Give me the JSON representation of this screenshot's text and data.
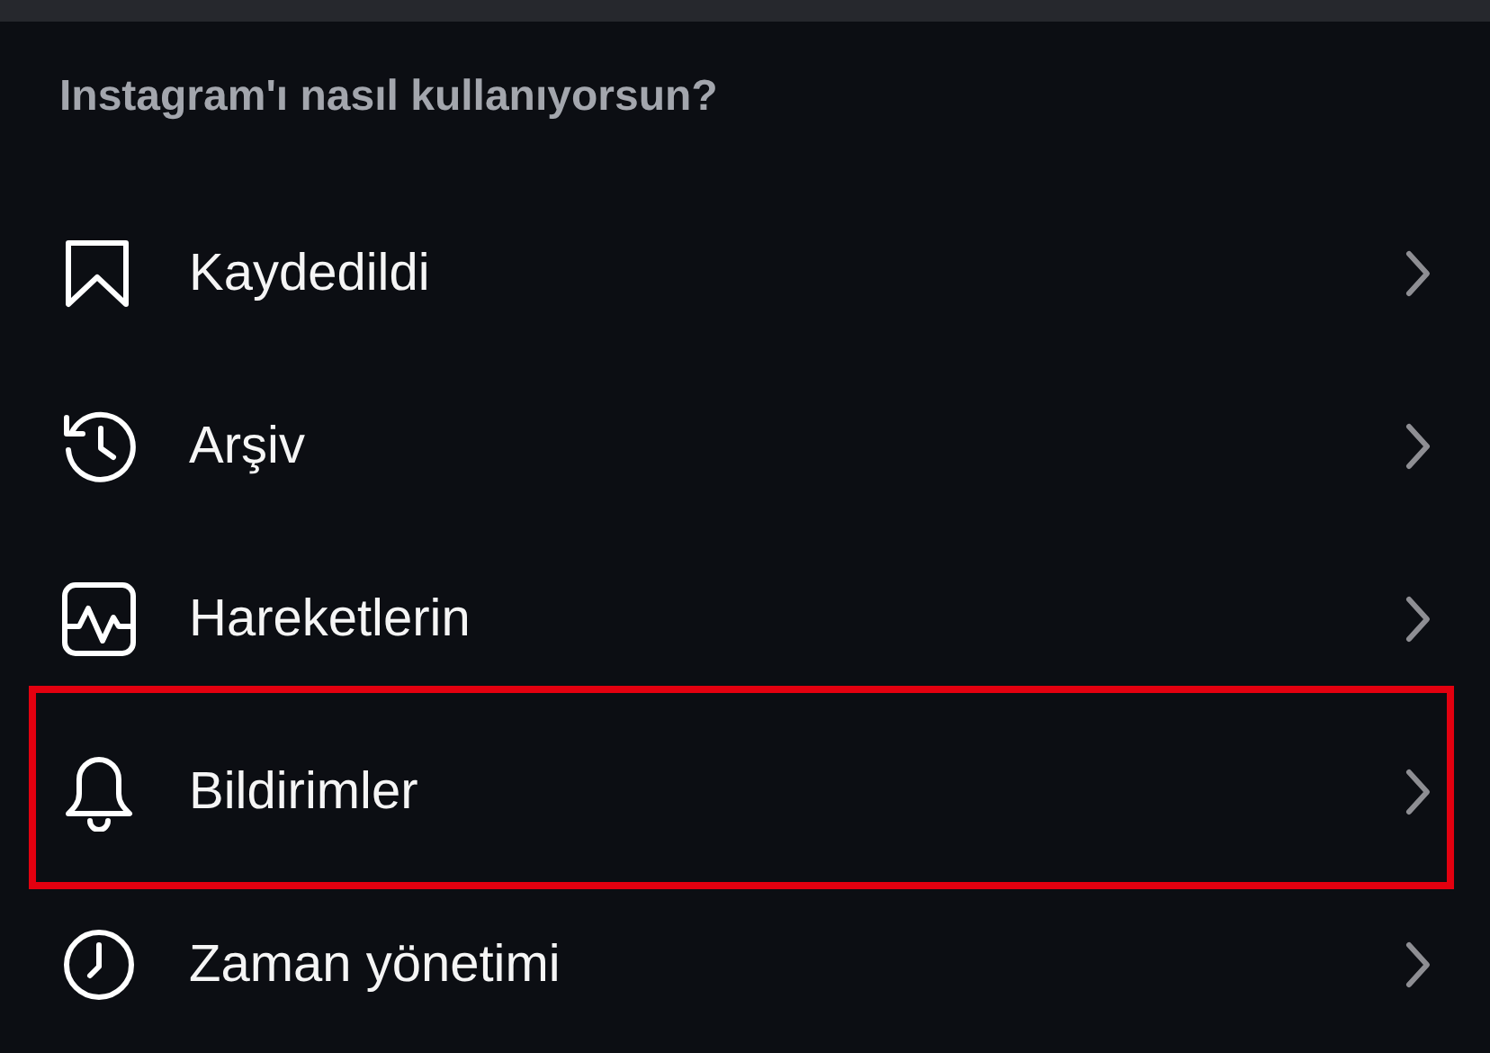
{
  "section": {
    "title": "Instagram'ı nasıl kullanıyorsun?"
  },
  "items": [
    {
      "kind": "saved",
      "label": "Kaydedildi",
      "highlighted": false
    },
    {
      "kind": "archive",
      "label": "Arşiv",
      "highlighted": false
    },
    {
      "kind": "activity",
      "label": "Hareketlerin",
      "highlighted": false
    },
    {
      "kind": "notifications",
      "label": "Bildirimler",
      "highlighted": true
    },
    {
      "kind": "time",
      "label": "Zaman yönetimi",
      "highlighted": false
    }
  ]
}
